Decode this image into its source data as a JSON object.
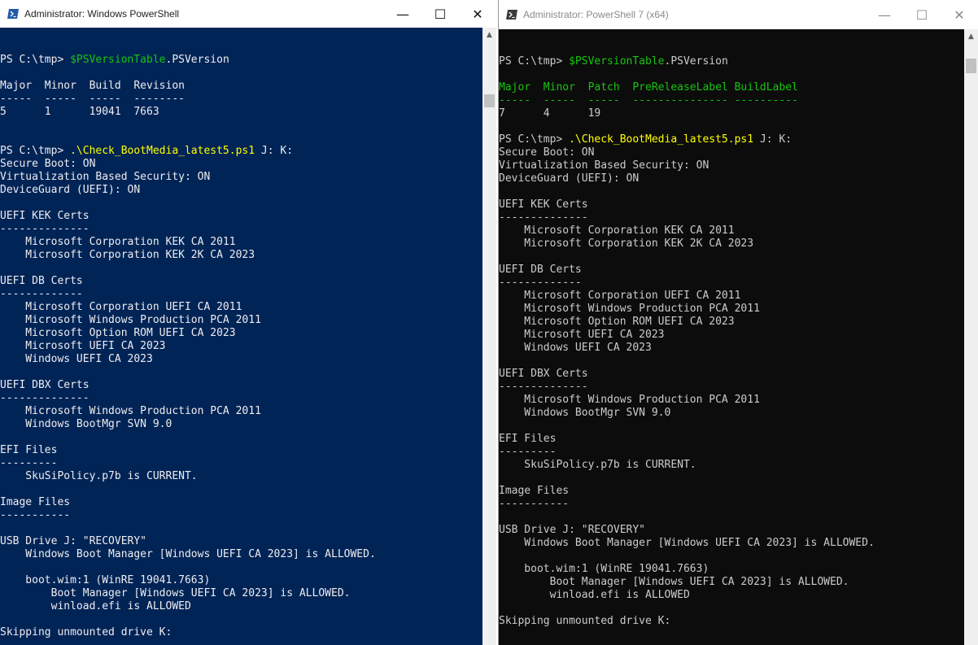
{
  "windows": [
    {
      "title": "Administrator: Windows PowerShell",
      "icon": "powershell-icon",
      "background": "#012456",
      "controls": {
        "minimize": "—",
        "maximize": "☐",
        "close": "✕"
      },
      "lines": [
        {
          "parts": [
            {
              "t": "PS C:\\tmp> "
            },
            {
              "t": "$PSVersionTable",
              "c": "var"
            },
            {
              "t": ".PSVersion"
            }
          ]
        },
        {
          "parts": []
        },
        {
          "parts": [
            {
              "t": "Major  Minor  Build  Revision"
            }
          ]
        },
        {
          "parts": [
            {
              "t": "-----  -----  -----  --------"
            }
          ]
        },
        {
          "parts": [
            {
              "t": "5      1      19041  7663"
            }
          ]
        },
        {
          "parts": []
        },
        {
          "parts": []
        },
        {
          "parts": [
            {
              "t": "PS C:\\tmp> "
            },
            {
              "t": ".\\Check_BootMedia_latest5.ps1",
              "c": "cmd"
            },
            {
              "t": " J: K:"
            }
          ]
        },
        {
          "parts": [
            {
              "t": "Secure Boot: ON"
            }
          ]
        },
        {
          "parts": [
            {
              "t": "Virtualization Based Security: ON"
            }
          ]
        },
        {
          "parts": [
            {
              "t": "DeviceGuard (UEFI): ON"
            }
          ]
        },
        {
          "parts": []
        },
        {
          "parts": [
            {
              "t": "UEFI KEK Certs"
            }
          ]
        },
        {
          "parts": [
            {
              "t": "--------------"
            }
          ]
        },
        {
          "parts": [
            {
              "t": "    Microsoft Corporation KEK CA 2011"
            }
          ]
        },
        {
          "parts": [
            {
              "t": "    Microsoft Corporation KEK 2K CA 2023"
            }
          ]
        },
        {
          "parts": []
        },
        {
          "parts": [
            {
              "t": "UEFI DB Certs"
            }
          ]
        },
        {
          "parts": [
            {
              "t": "-------------"
            }
          ]
        },
        {
          "parts": [
            {
              "t": "    Microsoft Corporation UEFI CA 2011"
            }
          ]
        },
        {
          "parts": [
            {
              "t": "    Microsoft Windows Production PCA 2011"
            }
          ]
        },
        {
          "parts": [
            {
              "t": "    Microsoft Option ROM UEFI CA 2023"
            }
          ]
        },
        {
          "parts": [
            {
              "t": "    Microsoft UEFI CA 2023"
            }
          ]
        },
        {
          "parts": [
            {
              "t": "    Windows UEFI CA 2023"
            }
          ]
        },
        {
          "parts": []
        },
        {
          "parts": [
            {
              "t": "UEFI DBX Certs"
            }
          ]
        },
        {
          "parts": [
            {
              "t": "--------------"
            }
          ]
        },
        {
          "parts": [
            {
              "t": "    Microsoft Windows Production PCA 2011"
            }
          ]
        },
        {
          "parts": [
            {
              "t": "    Windows BootMgr SVN 9.0"
            }
          ]
        },
        {
          "parts": []
        },
        {
          "parts": [
            {
              "t": "EFI Files"
            }
          ]
        },
        {
          "parts": [
            {
              "t": "---------"
            }
          ]
        },
        {
          "parts": [
            {
              "t": "    SkuSiPolicy.p7b is CURRENT."
            }
          ]
        },
        {
          "parts": []
        },
        {
          "parts": [
            {
              "t": "Image Files"
            }
          ]
        },
        {
          "parts": [
            {
              "t": "-----------"
            }
          ]
        },
        {
          "parts": []
        },
        {
          "parts": [
            {
              "t": "USB Drive J: \"RECOVERY\""
            }
          ]
        },
        {
          "parts": [
            {
              "t": "    Windows Boot Manager [Windows UEFI CA 2023] is ALLOWED."
            }
          ]
        },
        {
          "parts": []
        },
        {
          "parts": [
            {
              "t": "    boot.wim:1 (WinRE 19041.7663)"
            }
          ]
        },
        {
          "parts": [
            {
              "t": "        Boot Manager [Windows UEFI CA 2023] is ALLOWED."
            }
          ]
        },
        {
          "parts": [
            {
              "t": "        winload.efi is ALLOWED"
            }
          ]
        },
        {
          "parts": []
        },
        {
          "parts": [
            {
              "t": "Skipping unmounted drive K:"
            }
          ]
        }
      ]
    },
    {
      "title": "Administrator: PowerShell 7 (x64)",
      "icon": "powershell-7-icon",
      "background": "#0c0c0c",
      "controls": {
        "minimize": "—",
        "maximize": "☐",
        "close": "✕"
      },
      "lines": [
        {
          "parts": [
            {
              "t": "PS C:\\tmp> "
            },
            {
              "t": "$PSVersionTable",
              "c": "var"
            },
            {
              "t": ".PSVersion"
            }
          ]
        },
        {
          "parts": []
        },
        {
          "parts": [
            {
              "t": "Major  Minor  Patch  PreReleaseLabel BuildLabel",
              "c": "hdr"
            }
          ]
        },
        {
          "parts": [
            {
              "t": "-----  -----  -----  --------------- ----------",
              "c": "hdr"
            }
          ]
        },
        {
          "parts": [
            {
              "t": "7      4      19"
            }
          ]
        },
        {
          "parts": []
        },
        {
          "parts": [
            {
              "t": "PS C:\\tmp> "
            },
            {
              "t": ".\\Check_BootMedia_latest5.ps1",
              "c": "cmd"
            },
            {
              "t": " J: K:"
            }
          ]
        },
        {
          "parts": [
            {
              "t": "Secure Boot: ON"
            }
          ]
        },
        {
          "parts": [
            {
              "t": "Virtualization Based Security: ON"
            }
          ]
        },
        {
          "parts": [
            {
              "t": "DeviceGuard (UEFI): ON"
            }
          ]
        },
        {
          "parts": []
        },
        {
          "parts": [
            {
              "t": "UEFI KEK Certs"
            }
          ]
        },
        {
          "parts": [
            {
              "t": "--------------"
            }
          ]
        },
        {
          "parts": [
            {
              "t": "    Microsoft Corporation KEK CA 2011"
            }
          ]
        },
        {
          "parts": [
            {
              "t": "    Microsoft Corporation KEK 2K CA 2023"
            }
          ]
        },
        {
          "parts": []
        },
        {
          "parts": [
            {
              "t": "UEFI DB Certs"
            }
          ]
        },
        {
          "parts": [
            {
              "t": "-------------"
            }
          ]
        },
        {
          "parts": [
            {
              "t": "    Microsoft Corporation UEFI CA 2011"
            }
          ]
        },
        {
          "parts": [
            {
              "t": "    Microsoft Windows Production PCA 2011"
            }
          ]
        },
        {
          "parts": [
            {
              "t": "    Microsoft Option ROM UEFI CA 2023"
            }
          ]
        },
        {
          "parts": [
            {
              "t": "    Microsoft UEFI CA 2023"
            }
          ]
        },
        {
          "parts": [
            {
              "t": "    Windows UEFI CA 2023"
            }
          ]
        },
        {
          "parts": []
        },
        {
          "parts": [
            {
              "t": "UEFI DBX Certs"
            }
          ]
        },
        {
          "parts": [
            {
              "t": "--------------"
            }
          ]
        },
        {
          "parts": [
            {
              "t": "    Microsoft Windows Production PCA 2011"
            }
          ]
        },
        {
          "parts": [
            {
              "t": "    Windows BootMgr SVN 9.0"
            }
          ]
        },
        {
          "parts": []
        },
        {
          "parts": [
            {
              "t": "EFI Files"
            }
          ]
        },
        {
          "parts": [
            {
              "t": "---------"
            }
          ]
        },
        {
          "parts": [
            {
              "t": "    SkuSiPolicy.p7b is CURRENT."
            }
          ]
        },
        {
          "parts": []
        },
        {
          "parts": [
            {
              "t": "Image Files"
            }
          ]
        },
        {
          "parts": [
            {
              "t": "-----------"
            }
          ]
        },
        {
          "parts": []
        },
        {
          "parts": [
            {
              "t": "USB Drive J: \"RECOVERY\""
            }
          ]
        },
        {
          "parts": [
            {
              "t": "    Windows Boot Manager [Windows UEFI CA 2023] is ALLOWED."
            }
          ]
        },
        {
          "parts": []
        },
        {
          "parts": [
            {
              "t": "    boot.wim:1 (WinRE 19041.7663)"
            }
          ]
        },
        {
          "parts": [
            {
              "t": "        Boot Manager [Windows UEFI CA 2023] is ALLOWED."
            }
          ]
        },
        {
          "parts": [
            {
              "t": "        winload.efi is ALLOWED"
            }
          ]
        },
        {
          "parts": []
        },
        {
          "parts": [
            {
              "t": "Skipping unmounted drive K:"
            }
          ]
        }
      ]
    }
  ]
}
